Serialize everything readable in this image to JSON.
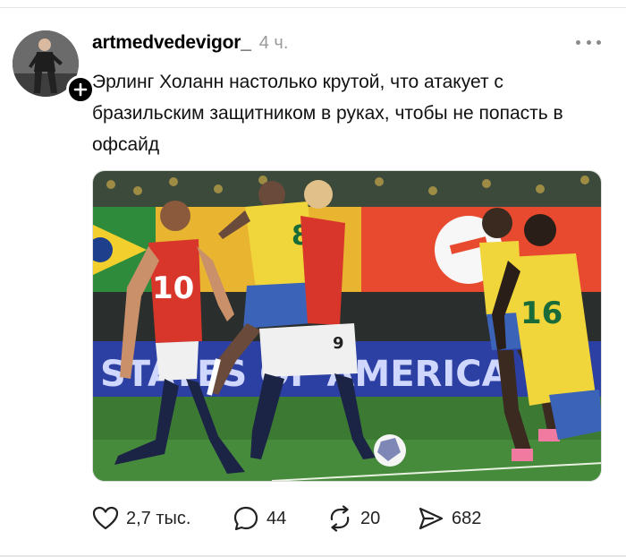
{
  "post": {
    "author": {
      "username": "artmedvedevigor_",
      "avatar_icon": "user-avatar-photo",
      "follow_icon": "plus-icon"
    },
    "timestamp": "4 ч.",
    "more_icon": "more-horizontal-icon",
    "text": "Эрлинг Холанн настолько крутой, что атакует с бразильским защитником в руках, чтобы не попасть в офсайд",
    "image": {
      "description_icon": "football-match-photo",
      "player_numbers": [
        "10",
        "8",
        "16",
        "9"
      ],
      "banner_text": "STATES OF AMERICA"
    },
    "actions": {
      "like": {
        "icon": "heart-icon",
        "count": "2,7 тыс."
      },
      "reply": {
        "icon": "comment-bubble-icon",
        "count": "44"
      },
      "repost": {
        "icon": "repost-arrows-icon",
        "count": "20"
      },
      "share": {
        "icon": "send-icon",
        "count": "682"
      }
    }
  },
  "colors": {
    "text": "#111111",
    "muted": "#9a9a9a",
    "badge": "#000000"
  }
}
